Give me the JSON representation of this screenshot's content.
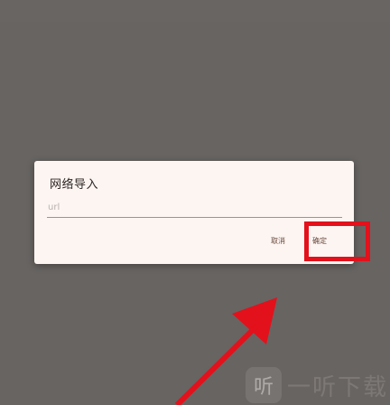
{
  "dialog": {
    "title": "网络导入",
    "url_input": {
      "value": "",
      "placeholder": "url"
    },
    "cancel_label": "取消",
    "confirm_label": "确定"
  },
  "annotation": {
    "highlight_color": "#e3111b",
    "arrow_color": "#e3111b"
  },
  "watermark": {
    "logo_glyph": "听",
    "text": "一听下载"
  }
}
